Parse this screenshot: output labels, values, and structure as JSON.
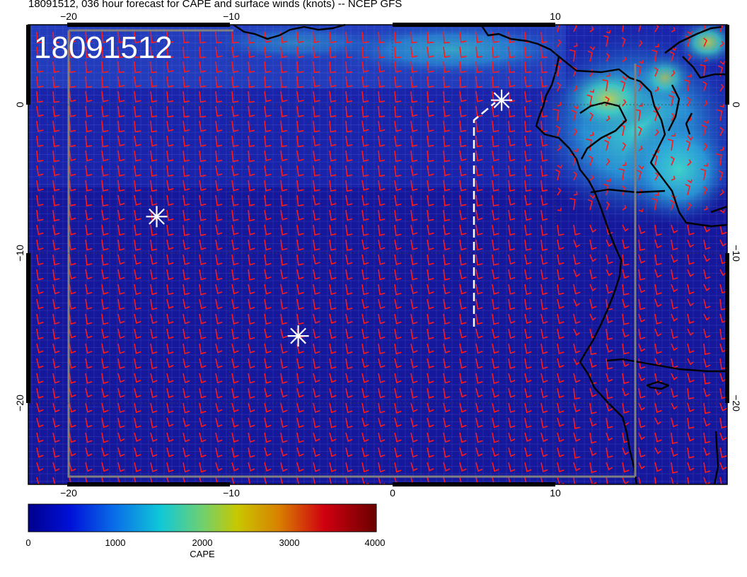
{
  "title": "18091512, 036 hour forecast for CAPE and surface winds (knots) -- NCEP GFS",
  "stamp": "18091512",
  "axes": {
    "lon_ticks": [
      "−20",
      "−10",
      "0",
      "10"
    ],
    "lat_ticks": [
      "0",
      "−10",
      "−20"
    ]
  },
  "colorbar": {
    "title": "CAPE",
    "ticks": [
      "0",
      "1000",
      "2000",
      "3000",
      "4000"
    ],
    "range": [
      0,
      4000
    ]
  },
  "colors": {
    "background_low": "#1a1f9e",
    "barbs": "#ff1a1a",
    "coast": "#000000",
    "markers": "#ffffff"
  },
  "markers": [
    {
      "name": "storm-marker-west",
      "lon": -14.5,
      "lat": -7.5
    },
    {
      "name": "storm-marker-south",
      "lon": -5.8,
      "lat": -15.5
    },
    {
      "name": "storm-marker-north",
      "lon": 6.7,
      "lat": 0.3
    }
  ]
}
